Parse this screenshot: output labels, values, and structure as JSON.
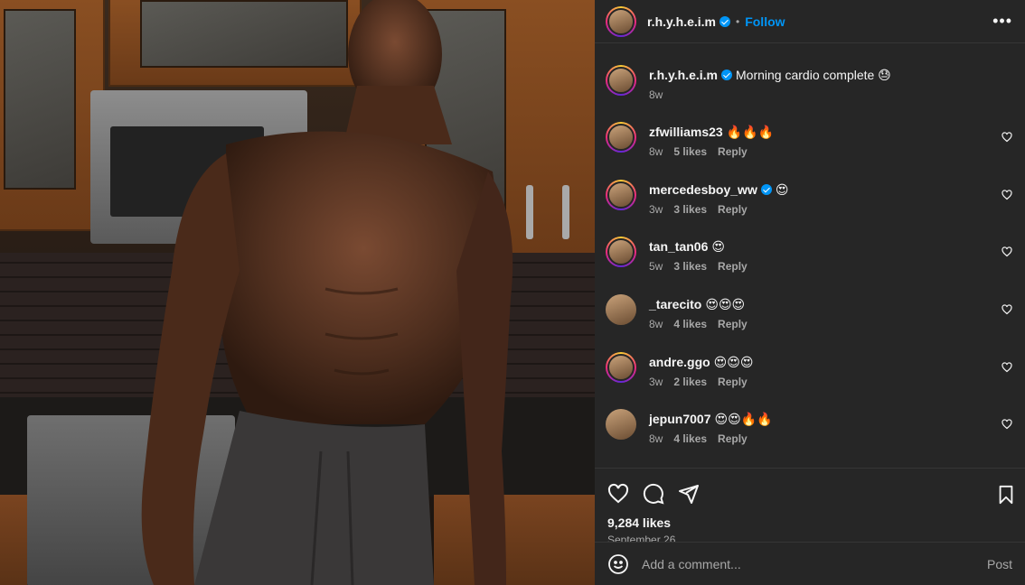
{
  "post": {
    "author": "r.h.y.h.e.i.m",
    "follow_label": "Follow",
    "more_icon": "more-options-icon",
    "caption": {
      "username": "r.h.y.h.e.i.m",
      "text": "Morning cardio complete 😓",
      "time": "8w"
    },
    "likes_count": "9,284 likes",
    "date": "September 26",
    "add_comment_placeholder": "Add a comment...",
    "post_label": "Post"
  },
  "comments": [
    {
      "username": "zfwilliams23",
      "text": "🔥🔥🔥",
      "time": "8w",
      "likes": "5 likes",
      "reply": "Reply",
      "verified": false,
      "ring": true
    },
    {
      "username": "mercedesboy_ww",
      "text": "😍",
      "time": "3w",
      "likes": "3 likes",
      "reply": "Reply",
      "verified": true,
      "ring": true
    },
    {
      "username": "tan_tan06",
      "text": "😍",
      "time": "5w",
      "likes": "3 likes",
      "reply": "Reply",
      "verified": false,
      "ring": true
    },
    {
      "username": "_tarecito",
      "text": "😍😍😍",
      "time": "8w",
      "likes": "4 likes",
      "reply": "Reply",
      "verified": false,
      "ring": false
    },
    {
      "username": "andre.ggo",
      "text": "😍😍😍",
      "time": "3w",
      "likes": "2 likes",
      "reply": "Reply",
      "verified": false,
      "ring": true
    },
    {
      "username": "jepun7007",
      "text": "😍😍🔥🔥",
      "time": "8w",
      "likes": "4 likes",
      "reply": "Reply",
      "verified": false,
      "ring": false
    }
  ],
  "colors": {
    "panel_bg": "#262626",
    "accent": "#0095f6",
    "muted": "#a8a8a8"
  }
}
